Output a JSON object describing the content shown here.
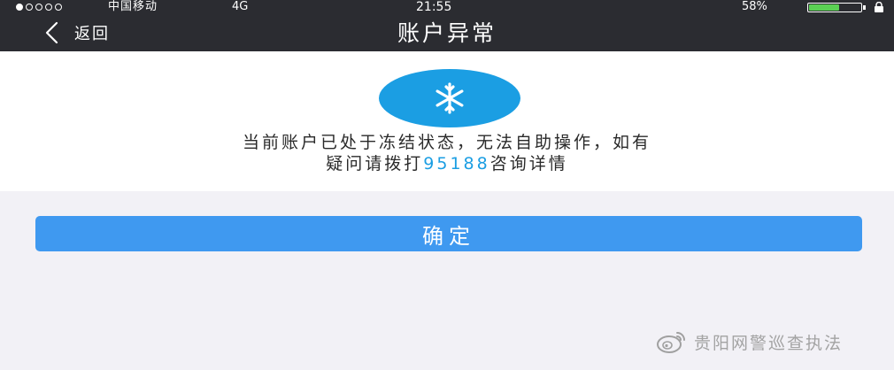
{
  "status_bar": {
    "carrier": "中国移动",
    "network": "4G",
    "time": "21:55",
    "battery_percent": "58%",
    "battery_level": 0.58,
    "signal_dots_filled": 1,
    "signal_dots_total": 5
  },
  "nav": {
    "back_label": "返回",
    "title": "账户异常",
    "back_icon": "chevron-left-icon"
  },
  "notice": {
    "icon": "snowflake-icon",
    "line1": "当前账户已处于冻结状态，无法自助操作，如有",
    "line2_prefix": "疑问请拨打",
    "hotline": "95188",
    "line2_suffix": "咨询详情"
  },
  "confirm_label": "确定",
  "watermark": {
    "icon": "weibo-icon",
    "text": "贵阳网警巡查执法"
  },
  "colors": {
    "topbar": "#2b2c31",
    "accent": "#1b9ee3",
    "button": "#3f99f0",
    "background": "#f2f1f6",
    "battery": "#5bd054"
  }
}
